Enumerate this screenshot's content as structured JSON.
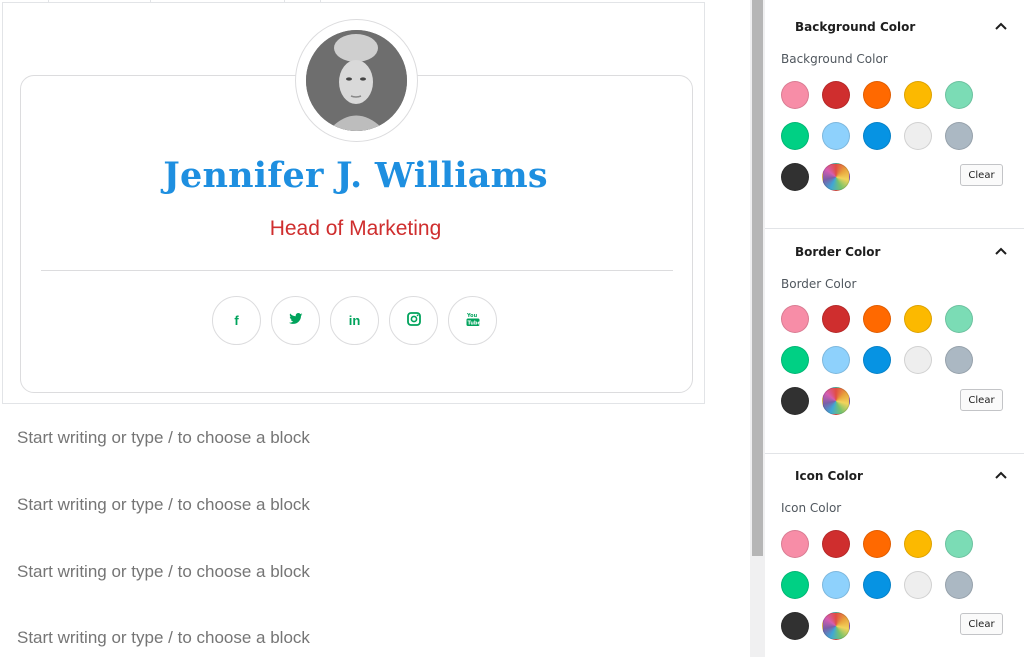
{
  "card": {
    "name": "Jennifer J. Williams",
    "title": "Head of Marketing",
    "colors": {
      "name": "#1e8fe0",
      "title": "#cf2e2e",
      "icon": "#00a35c"
    },
    "social": [
      {
        "icon": "facebook-icon",
        "glyph": "f"
      },
      {
        "icon": "twitter-icon",
        "glyph": "•"
      },
      {
        "icon": "linkedin-icon",
        "glyph": "in"
      },
      {
        "icon": "instagram-icon",
        "glyph": "▣"
      },
      {
        "icon": "youtube-icon",
        "glyph": "▶"
      }
    ]
  },
  "editor": {
    "placeholders": [
      "Start writing or type / to choose a block",
      "Start writing or type / to choose a block",
      "Start writing or type / to choose a block",
      "Start writing or type / to choose a block"
    ]
  },
  "sidebar": {
    "palette": [
      "#f78da7",
      "#cf2e2e",
      "#ff6900",
      "#fcb900",
      "#7bdcb5",
      "#00d084",
      "#8ed1fc",
      "#0693e3",
      "#eeeeee",
      "#abb8c3",
      "#313131",
      "multicolor"
    ],
    "clear_label": "Clear",
    "panels": [
      {
        "title": "Background Color",
        "label": "Background Color"
      },
      {
        "title": "Border Color",
        "label": "Border Color"
      },
      {
        "title": "Icon Color",
        "label": "Icon Color"
      }
    ]
  }
}
